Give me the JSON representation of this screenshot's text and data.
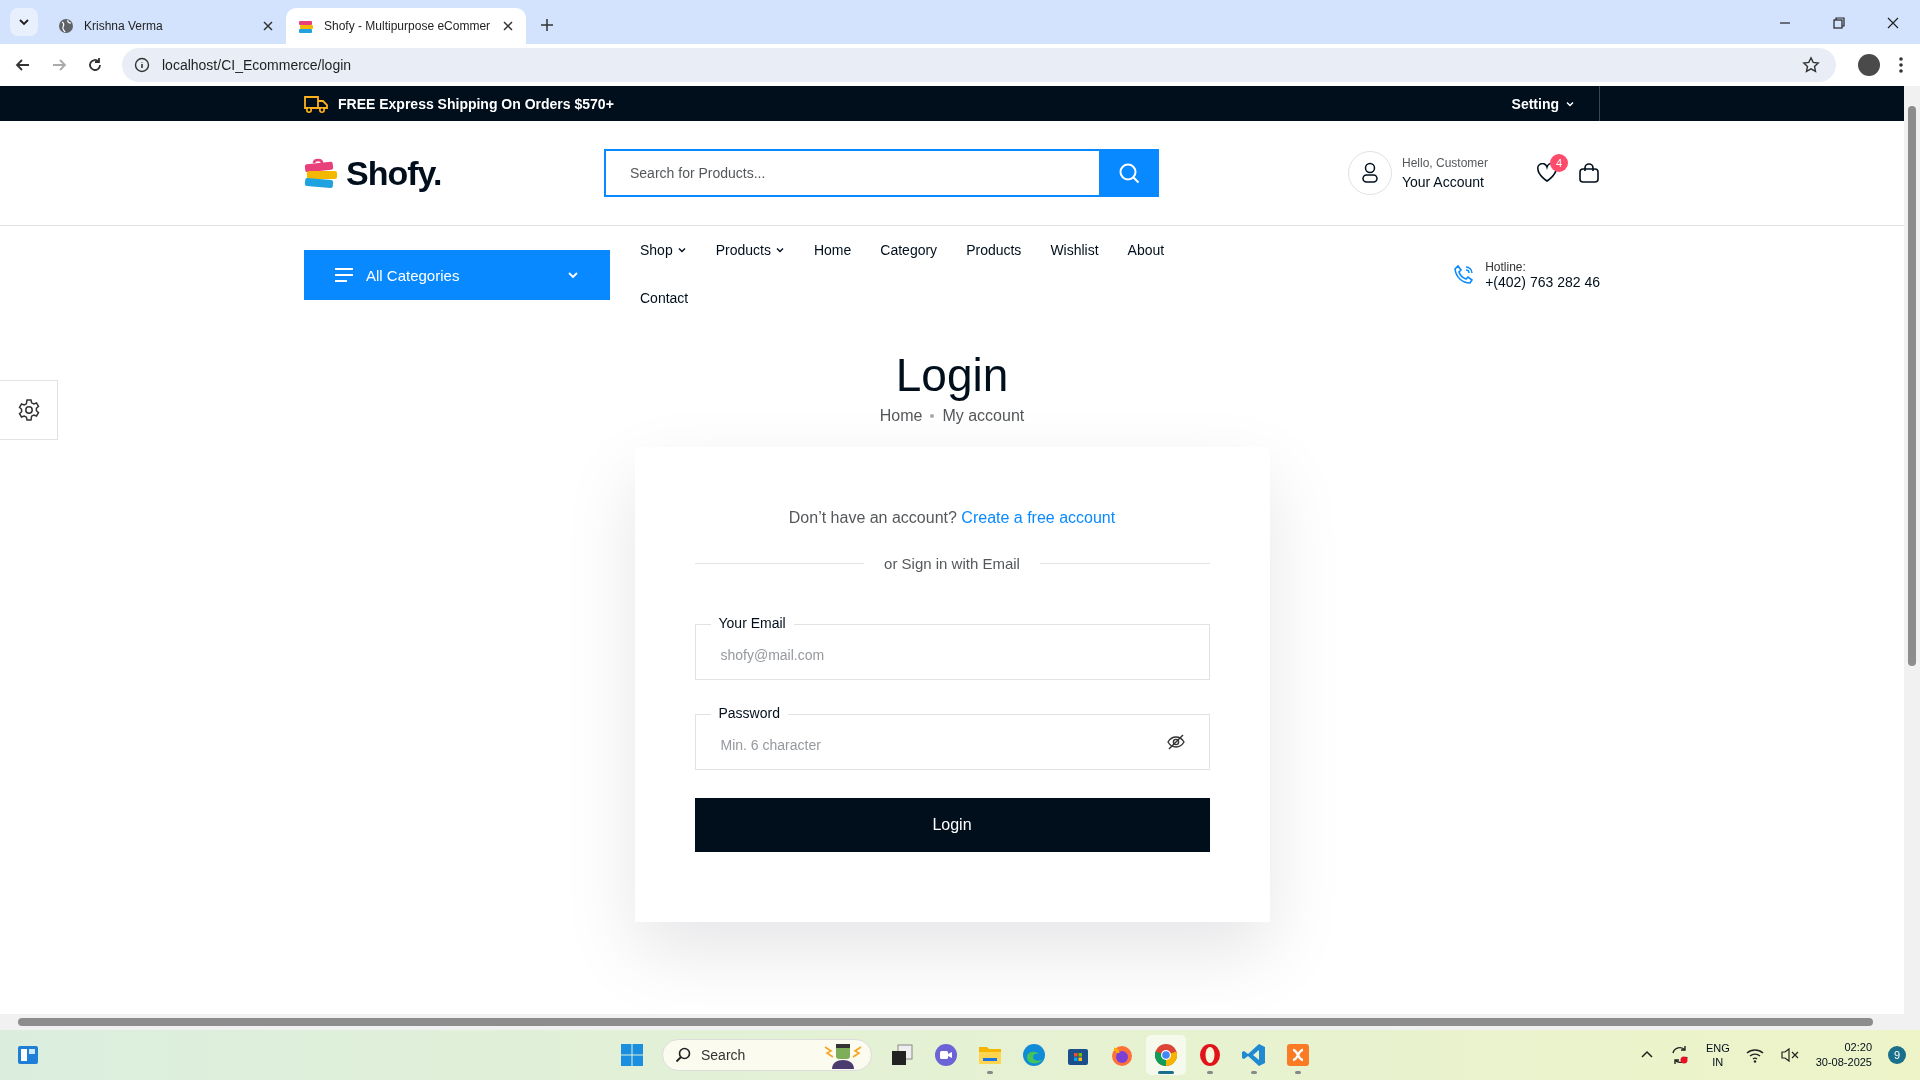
{
  "browser": {
    "tabs": [
      {
        "title": "Krishna Verma",
        "selected": false,
        "kind": "globe"
      },
      {
        "title": "Shofy - Multipurpose eCommer",
        "selected": true,
        "kind": "logo"
      }
    ],
    "url": "localhost/CI_Ecommerce/login"
  },
  "topbar": {
    "shipping": "FREE Express Shipping On Orders $570+",
    "setting": "Setting"
  },
  "header": {
    "logo": "Shofy.",
    "search_placeholder": "Search for Products...",
    "greeting": "Hello, Customer",
    "account": "Your Account",
    "wishlist_count": "4"
  },
  "nav": {
    "categories": "All Categories",
    "links": [
      "Shop",
      "Products",
      "Home",
      "Category",
      "Products",
      "Wishlist",
      "About",
      "Contact"
    ],
    "dropdown": [
      true,
      true,
      false,
      false,
      false,
      false,
      false,
      false
    ],
    "hotline_label": "Hotline:",
    "hotline": "+(402) 763 282 46"
  },
  "login": {
    "title": "Login",
    "breadcrumb": [
      "Home",
      "My account"
    ],
    "prompt": "Don’t have an account?",
    "link": "Create a free account",
    "divider": "or Sign in with Email",
    "fields": [
      {
        "label": "Your Email",
        "placeholder": "shofy@mail.com",
        "kind": "email"
      },
      {
        "label": "Password",
        "placeholder": "Min. 6 character",
        "kind": "password"
      }
    ],
    "button": "Login"
  },
  "taskbar": {
    "search": "Search",
    "apps": [
      {
        "kind": "windows",
        "running": false,
        "selected": false
      },
      {
        "kind": "desktops",
        "running": false,
        "selected": false
      },
      {
        "kind": "meet",
        "running": false,
        "selected": false
      },
      {
        "kind": "folder",
        "running": true,
        "selected": false
      },
      {
        "kind": "edge",
        "running": false,
        "selected": false
      },
      {
        "kind": "store",
        "running": false,
        "selected": false
      },
      {
        "kind": "fox",
        "running": false,
        "selected": false
      },
      {
        "kind": "chrome",
        "running": true,
        "selected": true
      },
      {
        "kind": "opera",
        "running": true,
        "selected": false
      },
      {
        "kind": "code",
        "running": true,
        "selected": false
      },
      {
        "kind": "xampp",
        "running": true,
        "selected": false
      }
    ],
    "language": [
      "ENG",
      "IN"
    ],
    "time": "02:20",
    "date": "30-08-2025",
    "notifications": "9"
  }
}
